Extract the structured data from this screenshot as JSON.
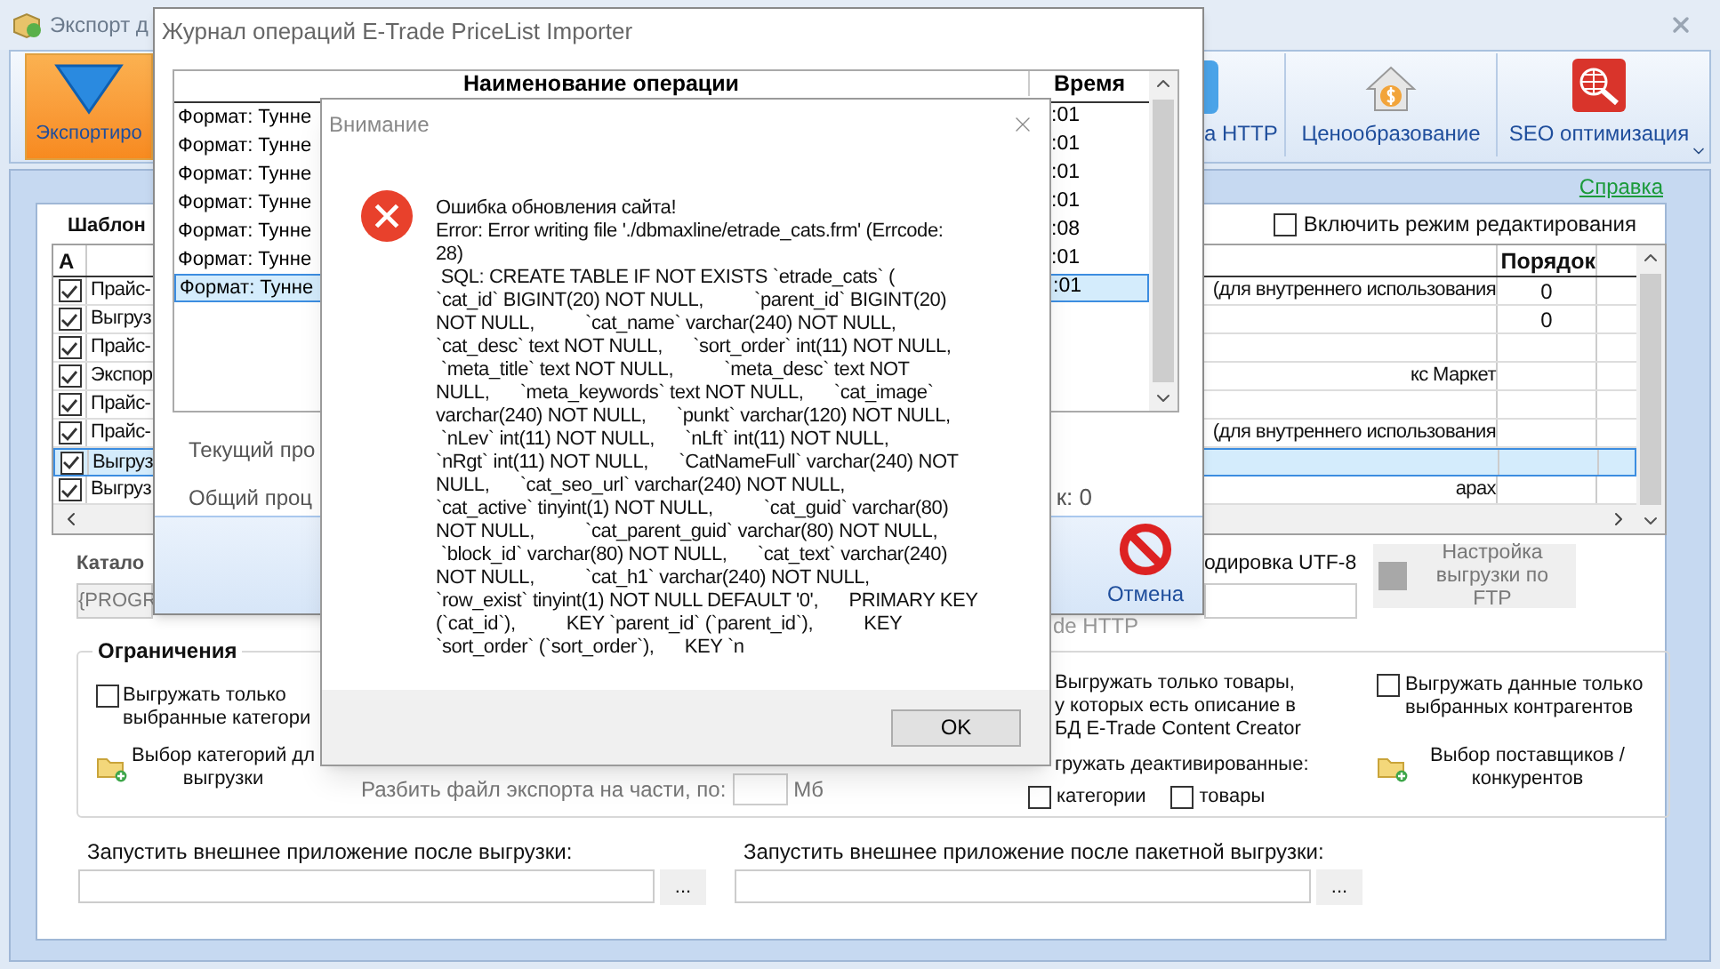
{
  "main_window": {
    "title": "Экспорт д",
    "ribbon": [
      {
        "label": "Экспортиро",
        "kind": "export",
        "selected": true
      },
      {
        "label": "а HTTP",
        "kind": "http",
        "selected": false
      },
      {
        "label": "Ценообразование",
        "kind": "pricing",
        "selected": false
      },
      {
        "label": "SEO оптимизация",
        "kind": "seo",
        "selected": false
      }
    ],
    "help_link": "Справка",
    "templates": {
      "label": "Шаблон",
      "edit_mode": {
        "label": "Включить режим редактирования",
        "checked": false
      },
      "columns": [
        "А",
        "Порядок"
      ],
      "rows": [
        {
          "checked": true,
          "name_start": "Прайс-",
          "name_end": "(для внутреннего использования",
          "order": "0",
          "selected": false
        },
        {
          "checked": true,
          "name_start": "Выгруз",
          "order": "0",
          "selected": false
        },
        {
          "checked": true,
          "name_start": "Прайс-",
          "selected": false
        },
        {
          "checked": true,
          "name_start": "Экспор",
          "name_end": "кс Маркет",
          "selected": false
        },
        {
          "checked": true,
          "name_start": "Прайс-",
          "selected": false
        },
        {
          "checked": true,
          "name_start": "Прайс-",
          "name_end": "(для внутреннего использования",
          "selected": false
        },
        {
          "checked": true,
          "name_start": "Выгруз",
          "selected": true
        },
        {
          "checked": true,
          "name_start": "Выгруз",
          "name_end": "арах",
          "selected": false
        }
      ]
    },
    "catalog": {
      "label": "Катало",
      "value": "{PROGR"
    },
    "encoding": {
      "label": "одировка UTF-8"
    },
    "ftp_button": "Настройка выгрузки по FTP",
    "http_note": "de HTTP",
    "limits": {
      "title": "Ограничения",
      "only_selected_categories": {
        "label": "Выгружать только\nвыбранные категори",
        "checked": false
      },
      "choose_categories": "Выбор категорий дл\nвыгрузки",
      "split": {
        "label": "Разбить файл экспорта на части, по:",
        "unit": "Мб"
      },
      "only_described": "Выгружать только товары,\nу которых есть описание в\nБД E-Trade Content Creator",
      "deactivated": {
        "label": "гружать деактивированные:",
        "options": [
          {
            "label": "категории",
            "checked": false
          },
          {
            "label": "товары",
            "checked": false
          }
        ]
      },
      "only_selected_contractors": {
        "label": "Выгружать данные только\nвыбранных контрагентов",
        "checked": false
      },
      "choose_suppliers": "Выбор поставщиков /\nконкурентов"
    },
    "run_after": [
      {
        "label": "Запустить внешнее приложение после выгрузки:",
        "button": "..."
      },
      {
        "label": "Запустить внешнее приложение после пакетной выгрузки:",
        "button": "..."
      }
    ]
  },
  "log_window": {
    "title": "Журнал операций E-Trade PriceList Importer",
    "columns": [
      "Наименование операции",
      "Время"
    ],
    "rows": [
      {
        "operation": "Формат: Тунне",
        "time": ":01",
        "selected": false
      },
      {
        "operation": "Формат: Тунне",
        "time": ":01",
        "selected": false
      },
      {
        "operation": "Формат: Тунне",
        "time": ":01",
        "selected": false
      },
      {
        "operation": "Формат: Тунне",
        "time": ":01",
        "selected": false
      },
      {
        "operation": "Формат: Тунне",
        "time": ":08",
        "selected": false
      },
      {
        "operation": "Формат: Тунне",
        "time": ":01",
        "selected": false
      },
      {
        "operation": "Формат: Тунне",
        "time": ":01",
        "selected": true
      }
    ],
    "current": "Текущий про",
    "total": "Общий проц",
    "count": "к: 0",
    "cancel": "Отмена"
  },
  "dialog": {
    "title": "Внимание",
    "message": "Ошибка обновления сайта!\nError: Error writing file './dbmaxline/etrade_cats.frm' (Errcode:\n28)\n SQL: CREATE TABLE IF NOT EXISTS `etrade_cats` (\n`cat_id` BIGINT(20) NOT NULL,          `parent_id` BIGINT(20)\nNOT NULL,          `cat_name` varchar(240) NOT NULL,\n`cat_desc` text NOT NULL,      `sort_order` int(11) NOT NULL,\n `meta_title` text NOT NULL,          `meta_desc` text NOT\nNULL,      `meta_keywords` text NOT NULL,      `cat_image`\nvarchar(240) NOT NULL,      `punkt` varchar(120) NOT NULL,\n `nLev` int(11) NOT NULL,      `nLft` int(11) NOT NULL,\n`nRgt` int(11) NOT NULL,      `CatNameFull` varchar(240) NOT\nNULL,      `cat_seo_url` varchar(240) NOT NULL,\n`cat_active` tinyint(1) NOT NULL,          `cat_guid` varchar(80)\nNOT NULL,          `cat_parent_guid` varchar(80) NOT NULL,\n `block_id` varchar(80) NOT NULL,      `cat_text` varchar(240)\nNOT NULL,          `cat_h1` varchar(240) NOT NULL,\n`row_exist` tinyint(1) NOT NULL DEFAULT '0',      PRIMARY KEY\n(`cat_id`),          KEY `parent_id` (`parent_id`),          KEY\n`sort_order` (`sort_order`),      KEY `n",
    "ok": "OK"
  }
}
